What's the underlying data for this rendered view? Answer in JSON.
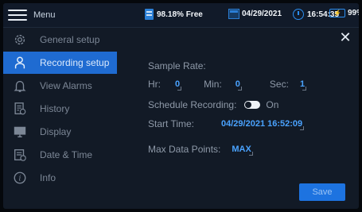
{
  "header": {
    "menu_label": "Menu",
    "storage_free": "98.18% Free",
    "date": "04/29/2021",
    "time": "16:54:35",
    "battery": "99%"
  },
  "sidebar": {
    "items": [
      {
        "label": "General setup",
        "icon": "gear-icon",
        "active": false
      },
      {
        "label": "Recording setup",
        "icon": "person-icon",
        "active": true
      },
      {
        "label": "View Alarms",
        "icon": "bell-icon",
        "active": false
      },
      {
        "label": "History",
        "icon": "history-document-icon",
        "active": false
      },
      {
        "label": "Display",
        "icon": "monitor-icon",
        "active": false
      },
      {
        "label": "Date & Time",
        "icon": "calendar-clock-icon",
        "active": false
      },
      {
        "label": "Info",
        "icon": "info-icon",
        "active": false
      }
    ]
  },
  "recording": {
    "sample_rate_label": "Sample Rate:",
    "hr_label": "Hr:",
    "hr_value": "0",
    "min_label": "Min:",
    "min_value": "0",
    "sec_label": "Sec:",
    "sec_value": "1",
    "schedule_label": "Schedule Recording:",
    "schedule_state": "On",
    "start_time_label": "Start Time:",
    "start_time_value": "04/29/2021 16:52:09",
    "max_points_label": "Max Data Points:",
    "max_points_value": "MAX",
    "save_label": "Save"
  },
  "colors": {
    "accent": "#1f6bd1",
    "value_blue": "#4aa3ff",
    "background": "#121a26"
  }
}
